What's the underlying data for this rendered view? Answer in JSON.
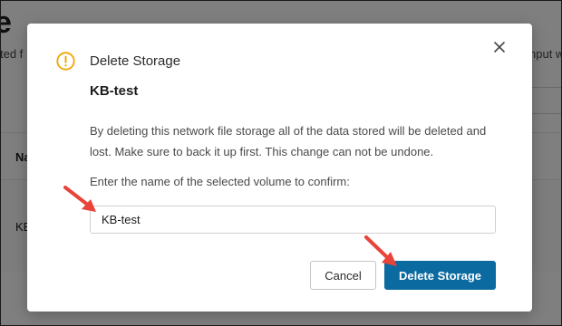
{
  "background": {
    "page_title": "e",
    "left_text": "ted f",
    "right_text": "hput wi",
    "column_header": "Na",
    "row_cell": "KE"
  },
  "dialog": {
    "icon": "warning-circle-icon",
    "title": "Delete Storage",
    "volume_name": "KB-test",
    "description": "By deleting this network file storage all of the data stored will be deleted and lost. Make sure to back it up first. This change can not be undone.",
    "confirm_label": "Enter the name of the selected volume to confirm:",
    "confirm_input_value": "KB-test",
    "cancel_label": "Cancel",
    "delete_label": "Delete Storage",
    "close_icon": "close-icon"
  },
  "annotations": {
    "arrow_color": "#e8443a",
    "arrow_icon": "red-arrow-icon"
  },
  "colors": {
    "primary_button": "#0b6aa0",
    "warning": "#f0a500"
  }
}
